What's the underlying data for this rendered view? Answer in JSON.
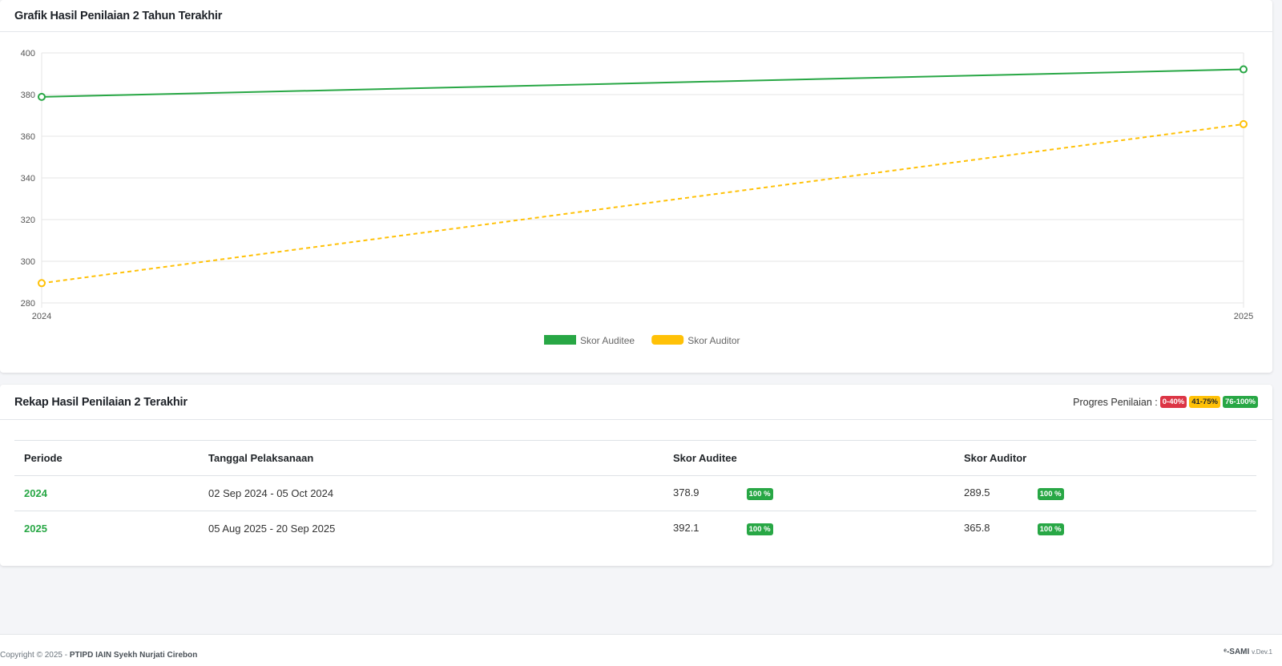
{
  "chart_card": {
    "title": "Grafik Hasil Penilaian 2 Tahun Terakhir"
  },
  "chart_data": {
    "type": "line",
    "x": [
      "2024",
      "2025"
    ],
    "ylim": [
      280,
      400
    ],
    "yticks": [
      400,
      380,
      360,
      340,
      320,
      300,
      280
    ],
    "series": [
      {
        "name": "Skor Auditee",
        "values": [
          378.9,
          392.1
        ],
        "color": "#28a745",
        "dashed": false
      },
      {
        "name": "Skor Auditor",
        "values": [
          289.5,
          365.8
        ],
        "color": "#ffc107",
        "dashed": true
      }
    ],
    "grid": true,
    "legend": "bottom-center"
  },
  "table_card": {
    "title": "Rekap Hasil Penilaian 2 Terakhir",
    "progress_label": "Progres Penilaian :",
    "progress_badges": [
      {
        "label": "0-40%",
        "color": "#dc3545"
      },
      {
        "label": "41-75%",
        "color": "#ffc107"
      },
      {
        "label": "76-100%",
        "color": "#28a745"
      }
    ],
    "columns": [
      "Periode",
      "Tanggal Pelaksanaan",
      "Skor Auditee",
      "Skor Auditor"
    ],
    "rows": [
      {
        "periode": "2024",
        "tanggal": "02 Sep 2024 - 05 Oct 2024",
        "auditee": "378.9",
        "auditee_progress": "100 %",
        "auditor": "289.5",
        "auditor_progress": "100 %"
      },
      {
        "periode": "2025",
        "tanggal": "05 Aug 2025 - 20 Sep 2025",
        "auditee": "392.1",
        "auditee_progress": "100 %",
        "auditor": "365.8",
        "auditor_progress": "100 %"
      }
    ]
  },
  "footer": {
    "copyright": "Copyright © 2025 -",
    "org": "PTIPD IAIN Syekh Nurjati Cirebon",
    "brand": "ᵉ-SAMI",
    "version": "v.Dev.1"
  }
}
